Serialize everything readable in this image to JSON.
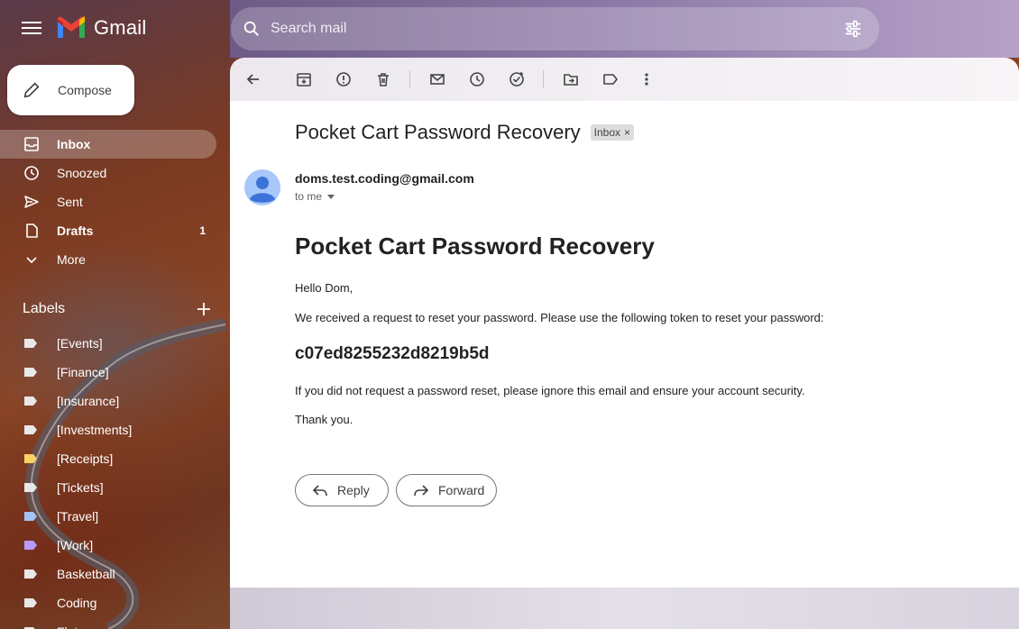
{
  "app": {
    "name": "Gmail"
  },
  "header": {
    "search_placeholder": "Search mail"
  },
  "sidebar": {
    "compose_label": "Compose",
    "nav": [
      {
        "label": "Inbox",
        "icon": "inbox-icon",
        "count": ""
      },
      {
        "label": "Snoozed",
        "icon": "clock-icon",
        "count": ""
      },
      {
        "label": "Sent",
        "icon": "send-icon",
        "count": ""
      },
      {
        "label": "Drafts",
        "icon": "draft-icon",
        "count": "1"
      },
      {
        "label": "More",
        "icon": "chevron-down-icon",
        "count": ""
      }
    ],
    "labels_title": "Labels",
    "labels": [
      {
        "label": "[Events]",
        "color": "#e8e8e8"
      },
      {
        "label": "[Finance]",
        "color": "#e8e8e8"
      },
      {
        "label": "[Insurance]",
        "color": "#e8e8e8"
      },
      {
        "label": "[Investments]",
        "color": "#e8e8e8"
      },
      {
        "label": "[Receipts]",
        "color": "#fad165"
      },
      {
        "label": "[Tickets]",
        "color": "#e8e8e8"
      },
      {
        "label": "[Travel]",
        "color": "#a4c2f4"
      },
      {
        "label": "[Work]",
        "color": "#b99aff"
      },
      {
        "label": "Basketball",
        "color": "#e8e8e8"
      },
      {
        "label": "Coding",
        "color": "#e8e8e8"
      },
      {
        "label": "Flat",
        "color": "#e8e8e8"
      }
    ]
  },
  "email": {
    "subject": "Pocket Cart Password Recovery",
    "chip_label": "Inbox",
    "chip_close": "×",
    "sender": "doms.test.coding@gmail.com",
    "recipient_line": "to me",
    "heading": "Pocket Cart Password Recovery",
    "greeting": "Hello Dom,",
    "line1": "We received a request to reset your password. Please use the following token to reset your password:",
    "token": "c07ed8255232d8219b5d",
    "line2": "If you did not request a password reset, please ignore this email and ensure your account security.",
    "signoff": "Thank you.",
    "reply_label": "Reply",
    "forward_label": "Forward"
  },
  "colors": {
    "accent_blue": "#1a73e8",
    "avatar_blue": "#4285f4"
  }
}
